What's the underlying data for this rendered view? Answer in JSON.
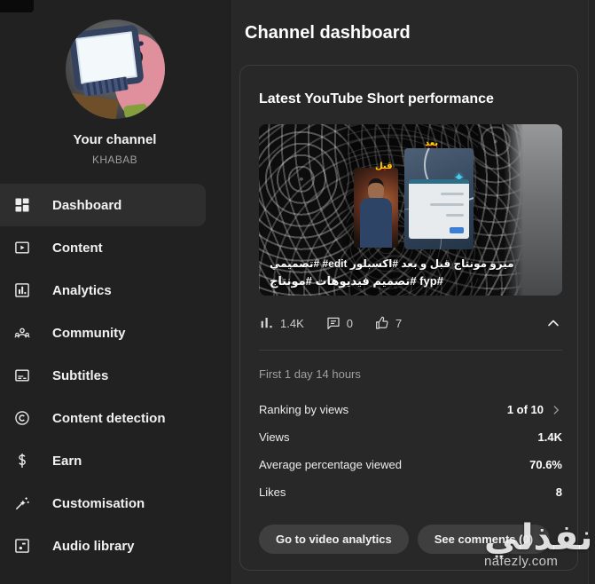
{
  "header": {
    "title": "Channel dashboard"
  },
  "sidebar": {
    "channel": {
      "label": "Your channel",
      "name": "KHABAB"
    },
    "items": [
      {
        "label": "Dashboard",
        "icon": "dashboard-icon",
        "selected": true
      },
      {
        "label": "Content",
        "icon": "content-icon",
        "selected": false
      },
      {
        "label": "Analytics",
        "icon": "analytics-icon",
        "selected": false
      },
      {
        "label": "Community",
        "icon": "community-icon",
        "selected": false
      },
      {
        "label": "Subtitles",
        "icon": "subtitles-icon",
        "selected": false
      },
      {
        "label": "Content detection",
        "icon": "content-detection-icon",
        "selected": false
      },
      {
        "label": "Earn",
        "icon": "earn-icon",
        "selected": false
      },
      {
        "label": "Customisation",
        "icon": "customisation-icon",
        "selected": false
      },
      {
        "label": "Audio library",
        "icon": "audio-library-icon",
        "selected": false
      }
    ]
  },
  "card": {
    "title": "Latest YouTube Short performance",
    "thumbnail": {
      "label_before": "قبل",
      "label_after": "بعد",
      "caption_line1": "تصميمي# #edit ميرو مونتاج قبل و بعد #اكسبلور",
      "caption_line2": "#fyp #تصميم فيديوهات #مونتاج"
    },
    "stats": {
      "views": "1.4K",
      "comments": "0",
      "likes": "7"
    },
    "period": "First 1 day 14 hours",
    "metrics": [
      {
        "label": "Ranking by views",
        "value": "1 of 10"
      },
      {
        "label": "Views",
        "value": "1.4K"
      },
      {
        "label": "Average percentage viewed",
        "value": "70.6%"
      },
      {
        "label": "Likes",
        "value": "8"
      }
    ],
    "buttons": {
      "analytics": "Go to video analytics",
      "comments": "See comments (0)"
    }
  },
  "watermark": {
    "text": "نفذلي",
    "domain": "nafezly.com"
  },
  "colors": {
    "sidebar_bg": "#212121",
    "main_bg": "#282828",
    "selected_bg": "#2e2e2e",
    "card_border": "#3d3d3d",
    "text": "#f1f1f1",
    "muted": "#9f9f9f",
    "button_bg": "#3f3f3f",
    "label_yellow": "#ffd400",
    "accent_cyan": "#44d0ec"
  }
}
